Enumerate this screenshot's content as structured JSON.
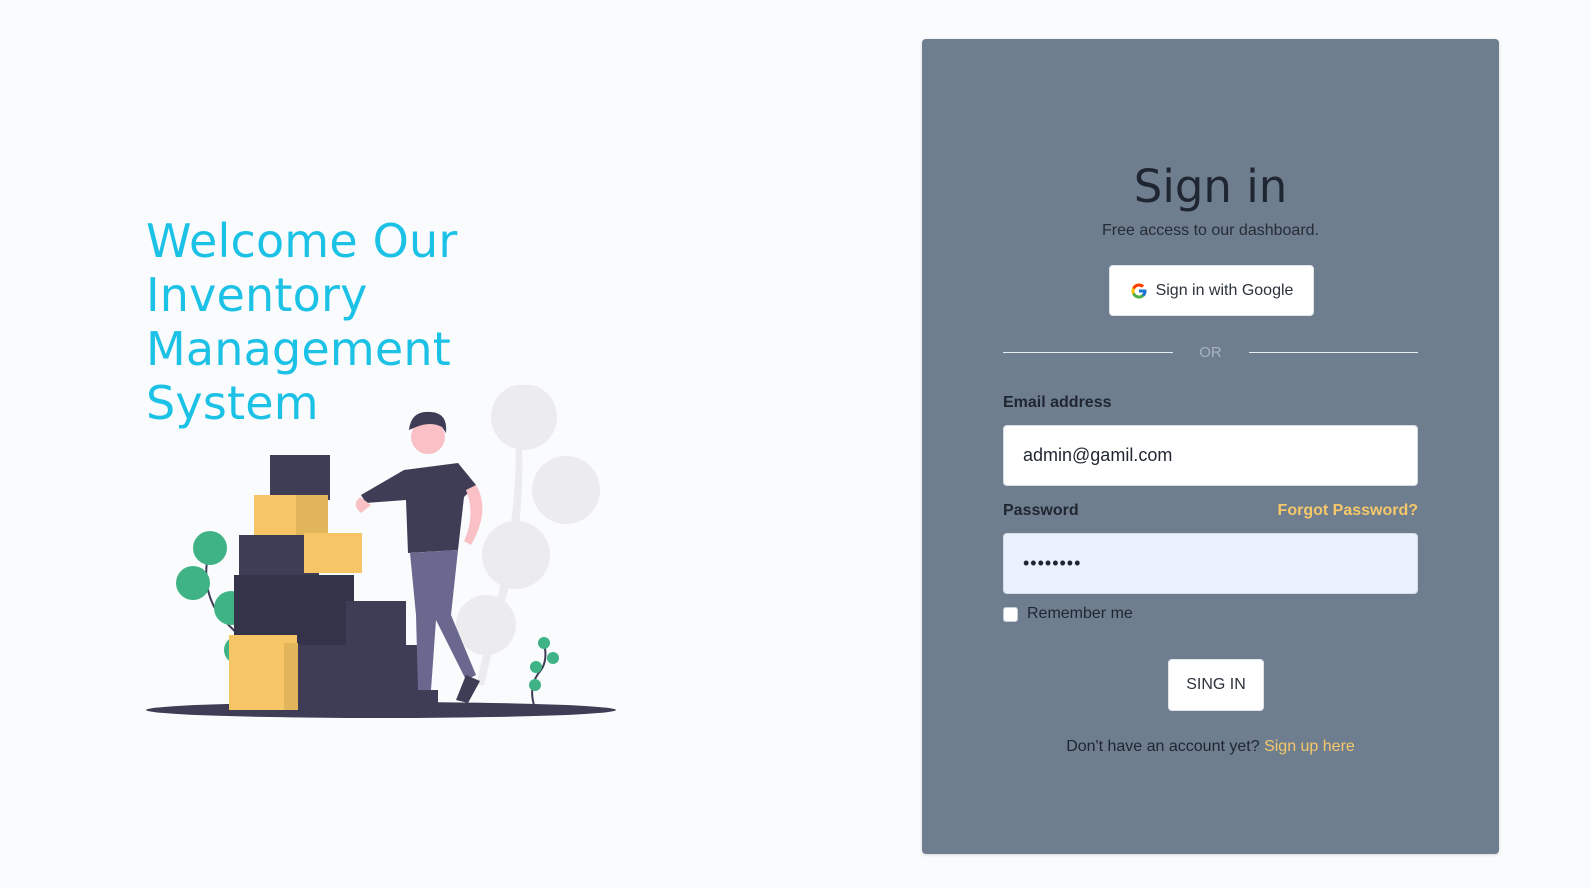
{
  "hero": {
    "title_line1": "Welcome Our",
    "title_line2": "Inventory",
    "title_line3": "Management System"
  },
  "signin": {
    "title": "Sign in",
    "subtitle": "Free access to our dashboard.",
    "google_button_label": "Sign in with Google",
    "or_text": "OR",
    "email_label": "Email address",
    "email_value": "admin@gamil.com",
    "password_label": "Password",
    "password_value": "••••••••",
    "forgot_password_label": "Forgot Password?",
    "remember_label": "Remember me",
    "remember_checked": false,
    "submit_label": "SING IN",
    "no_account_text": "Don't have an account yet?",
    "signup_link_label": "Sign up here"
  },
  "colors": {
    "page_background": "#f9fbfd",
    "hero_title": "#1cc2e6",
    "card_background": "#6f7e8f",
    "link_accent": "#f5c86a",
    "password_field_background": "#e9f0fe"
  },
  "icons": {
    "google": "google-g-icon",
    "illustration": "inventory-boxes-illustration"
  }
}
